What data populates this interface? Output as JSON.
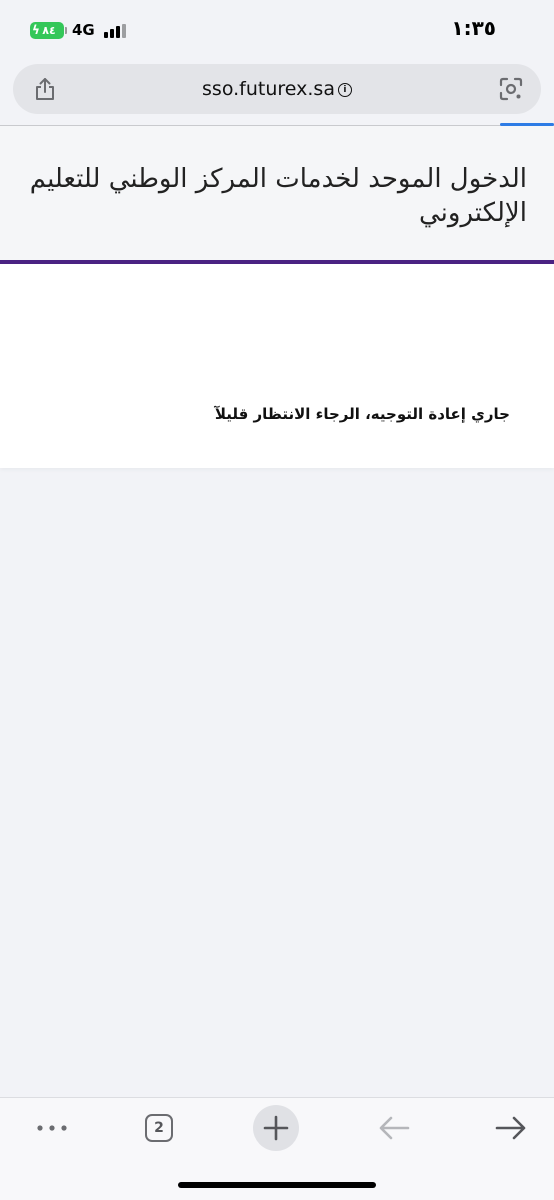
{
  "status_bar": {
    "battery": "٨٤",
    "network": "4G",
    "time": "١:٣٥"
  },
  "browser": {
    "url": "sso.futurex.sa",
    "open_tabs": "2",
    "accent_color": "#2d7be5"
  },
  "page": {
    "title": "الدخول الموحد لخدمات المركز الوطني للتعليم الإلكتروني",
    "message": "جاري إعادة التوجيه، الرجاء الانتظار قليلآ",
    "header_border_color": "#4a2382"
  },
  "toolbar": {
    "icons": [
      "more-icon",
      "tabs-icon",
      "plus-icon",
      "back-arrow-icon",
      "forward-arrow-icon"
    ]
  }
}
